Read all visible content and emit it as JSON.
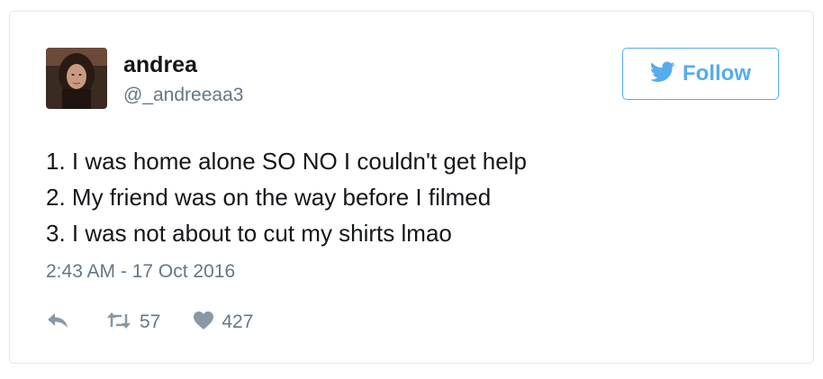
{
  "user": {
    "display_name": "andrea",
    "handle": "@_andreeaa3"
  },
  "follow_button": {
    "label": "Follow",
    "icon": "twitter-bird-icon",
    "color": "#55acee"
  },
  "tweet": {
    "lines": [
      "1. I was home alone SO NO I couldn't get help",
      "2. My friend was on the way before I filmed",
      "3. I was not about to cut my shirts lmao"
    ],
    "timestamp": "2:43 AM - 17 Oct 2016"
  },
  "actions": {
    "reply_icon": "reply-icon",
    "retweet_icon": "retweet-icon",
    "retweet_count": "57",
    "like_icon": "heart-icon",
    "like_count": "427"
  },
  "colors": {
    "text": "#14171a",
    "secondary": "#657786",
    "accent": "#55acee",
    "border": "#e1e8ed"
  }
}
